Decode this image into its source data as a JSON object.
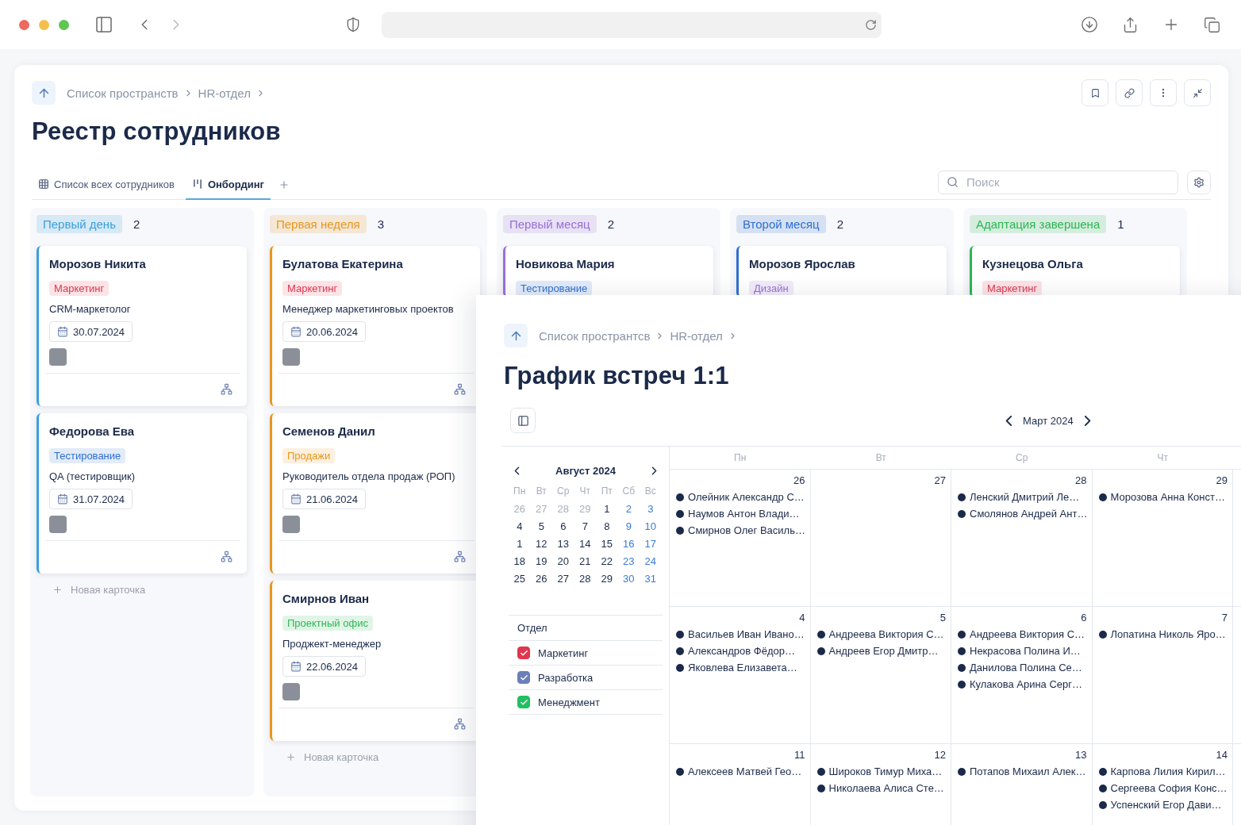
{
  "page": {
    "breadcrumbs": [
      "Список пространств",
      "HR-отдел"
    ],
    "title": "Реестр сотрудников",
    "tabs": [
      {
        "label": "Список всех сотрудников",
        "selected": false
      },
      {
        "label": "Онбординг",
        "selected": true
      }
    ],
    "search": {
      "placeholder": "Поиск"
    }
  },
  "board": {
    "columns": [
      {
        "label": "Первый день",
        "count": "2",
        "color": "#3a9fdc",
        "add_label": "Новая карточка",
        "cards": [
          {
            "name": "Морозов Никита",
            "tag": {
              "label": "Маркетинг",
              "color": "#e0364f"
            },
            "role": "CRM-маркетолог",
            "date": "30.07.2024"
          },
          {
            "name": "Федорова Ева",
            "tag": {
              "label": "Тестирование",
              "color": "#2f6fd1"
            },
            "role": "QA (тестировщик)",
            "date": "31.07.2024"
          }
        ]
      },
      {
        "label": "Первая неделя",
        "count": "3",
        "color": "#e8961e",
        "add_label": "Новая карточка",
        "cards": [
          {
            "name": "Булатова Екатерина",
            "tag": {
              "label": "Маркетинг",
              "color": "#e0364f"
            },
            "role": "Менеджер маркетинговых проектов",
            "date": "20.06.2024"
          },
          {
            "name": "Семенов Данил",
            "tag": {
              "label": "Продажи",
              "color": "#e8961e"
            },
            "role": "Руководитель отдела продаж (РОП)",
            "date": "21.06.2024"
          },
          {
            "name": "Смирнов Иван",
            "tag": {
              "label": "Проектный офис",
              "color": "#2db653"
            },
            "role": "Проджект-менеджер",
            "date": "22.06.2024"
          }
        ]
      },
      {
        "label": "Первый месяц",
        "count": "2",
        "color": "#9a6fd8",
        "cards": [
          {
            "name": "Новикова Мария",
            "tag": {
              "label": "Тестирование",
              "color": "#2f6fd1"
            }
          }
        ]
      },
      {
        "label": "Второй месяц",
        "count": "2",
        "color": "#2f6fd1",
        "cards": [
          {
            "name": "Морозов Ярослав",
            "tag": {
              "label": "Дизайн",
              "color": "#9a6fd8"
            }
          }
        ]
      },
      {
        "label": "Адаптация завершена",
        "count": "1",
        "color": "#2db653",
        "cards": [
          {
            "name": "Кузнецова Ольга",
            "tag": {
              "label": "Маркетинг",
              "color": "#e0364f"
            }
          }
        ]
      }
    ]
  },
  "calendar_panel": {
    "breadcrumbs": [
      "Список пространтсв",
      "HR-отдел"
    ],
    "title": "График встреч 1:1",
    "month": "Март 2024",
    "mini_calendar": {
      "month": "Август 2024",
      "weekdays": [
        "Пн",
        "Вт",
        "Ср",
        "Чт",
        "Пт",
        "Сб",
        "Вс"
      ],
      "weeks": [
        [
          {
            "day": "26",
            "outside": true
          },
          {
            "day": "27",
            "outside": true
          },
          {
            "day": "28",
            "outside": true
          },
          {
            "day": "29",
            "outside": true
          },
          {
            "day": "1",
            "outside": false
          },
          {
            "day": "2",
            "outside": false
          },
          {
            "day": "3",
            "outside": false
          }
        ],
        [
          {
            "day": "4",
            "outside": false
          },
          {
            "day": "5",
            "outside": false
          },
          {
            "day": "6",
            "outside": false
          },
          {
            "day": "7",
            "outside": false
          },
          {
            "day": "8",
            "outside": false
          },
          {
            "day": "9",
            "outside": false
          },
          {
            "day": "10",
            "outside": false
          }
        ],
        [
          {
            "day": "1",
            "outside": false
          },
          {
            "day": "12",
            "outside": false
          },
          {
            "day": "13",
            "outside": false
          },
          {
            "day": "14",
            "outside": false
          },
          {
            "day": "15",
            "outside": false
          },
          {
            "day": "16",
            "outside": false
          },
          {
            "day": "17",
            "outside": false
          }
        ],
        [
          {
            "day": "18",
            "outside": false
          },
          {
            "day": "19",
            "outside": false
          },
          {
            "day": "20",
            "outside": false
          },
          {
            "day": "21",
            "outside": false
          },
          {
            "day": "22",
            "outside": false
          },
          {
            "day": "23",
            "outside": false
          },
          {
            "day": "24",
            "outside": false
          }
        ],
        [
          {
            "day": "25",
            "outside": false
          },
          {
            "day": "26",
            "outside": false
          },
          {
            "day": "27",
            "outside": false
          },
          {
            "day": "28",
            "outside": false
          },
          {
            "day": "29",
            "outside": false
          },
          {
            "day": "30",
            "outside": false
          },
          {
            "day": "31",
            "outside": false
          }
        ]
      ]
    },
    "filter": {
      "title": "Отдел",
      "items": [
        {
          "label": "Маркетинг",
          "checked": true,
          "color": "#e0364f"
        },
        {
          "label": "Разработка",
          "checked": true,
          "color": "#6b80b8"
        },
        {
          "label": "Менеджмент",
          "checked": true,
          "color": "#22c063"
        }
      ]
    },
    "weekdays": [
      "Пн",
      "Вт",
      "Ср",
      "Чт"
    ],
    "weeks": [
      [
        {
          "day": "26",
          "events": [
            "Олейник Александр С…",
            "Наумов Антон Влади…",
            "Смирнов Олег Василь…"
          ]
        },
        {
          "day": "27"
        },
        {
          "day": "28",
          "events": [
            "Ленский Дмитрий Ле…",
            "Смолянов Андрей Ант…"
          ]
        },
        {
          "day": "29",
          "events": [
            "Морозова Анна Конст…"
          ]
        }
      ],
      [
        {
          "day": "4",
          "events": [
            "Васильев Иван Ивано…",
            "Александров Фёдор…",
            "Яковлева Елизавета…"
          ]
        },
        {
          "day": "5",
          "events": [
            "Андреева Виктория С…",
            "Андреев Егор Дмитр…"
          ]
        },
        {
          "day": "6",
          "events": [
            "Андреева Виктория С…",
            "Некрасова Полина И…",
            "Данилова Полина Се…",
            "Кулакова Арина Серг…"
          ]
        },
        {
          "day": "7",
          "events": [
            "Лопатина Николь Яро…"
          ]
        }
      ],
      [
        {
          "day": "11",
          "events": [
            "Алексеев Матвей Гео…"
          ]
        },
        {
          "day": "12",
          "events": [
            "Широков Тимур Миха…",
            "Николаева Алиса Сте…"
          ]
        },
        {
          "day": "13",
          "events": [
            "Потапов Михаил Алек…"
          ]
        },
        {
          "day": "14",
          "events": [
            "Карпова Лилия Кирил…",
            "Сергеева София Конс…",
            "Успенский Егор Дави…"
          ]
        }
      ]
    ]
  }
}
